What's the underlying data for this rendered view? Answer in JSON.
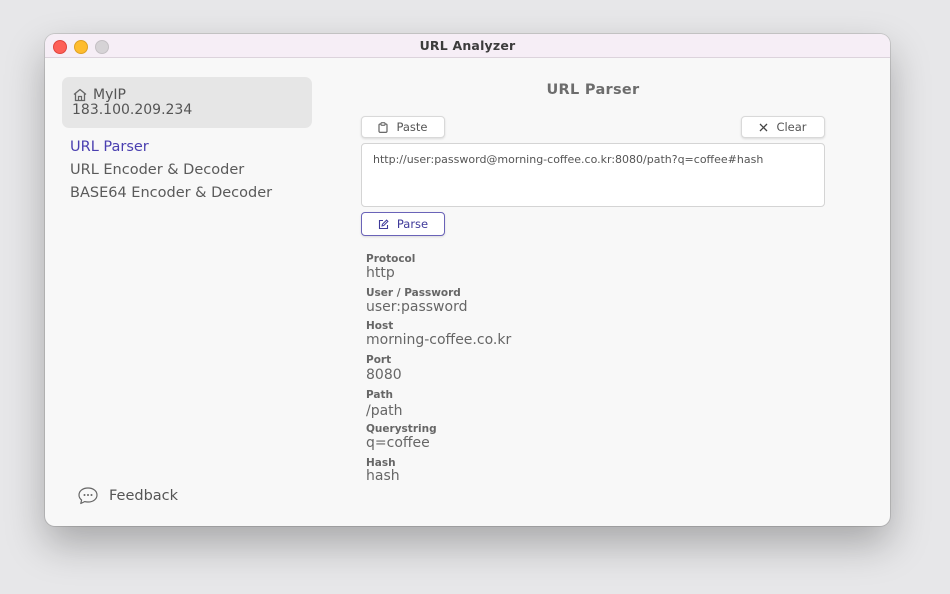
{
  "window": {
    "title": "URL Analyzer"
  },
  "sidebar": {
    "ip_label": "MyIP",
    "ip_value": "183.100.209.234",
    "items": [
      {
        "label": "URL Parser",
        "active": true
      },
      {
        "label": "URL Encoder & Decoder",
        "active": false
      },
      {
        "label": "BASE64 Encoder & Decoder",
        "active": false
      }
    ],
    "feedback_label": "Feedback"
  },
  "main": {
    "title": "URL Parser",
    "paste_label": "Paste",
    "clear_label": "Clear",
    "url_value": "http://user:password@morning-coffee.co.kr:8080/path?q=coffee#hash",
    "parse_label": "Parse",
    "fields": [
      {
        "label": "Protocol",
        "value": "http"
      },
      {
        "label": "User / Password",
        "value": "user:password"
      },
      {
        "label": "Host",
        "value": "morning-coffee.co.kr"
      },
      {
        "label": "Port",
        "value": "8080"
      },
      {
        "label": "Path",
        "value": "/path"
      },
      {
        "label": "Querystring",
        "value": "q=coffee"
      },
      {
        "label": "Hash",
        "value": "hash"
      }
    ]
  },
  "colors": {
    "accent": "#4a3fb0",
    "close": "#fe5f57",
    "minimize": "#febc2e"
  },
  "icons": [
    "home-icon",
    "clipboard-icon",
    "close-x-icon",
    "edit-icon",
    "chat-bubble-icon"
  ]
}
